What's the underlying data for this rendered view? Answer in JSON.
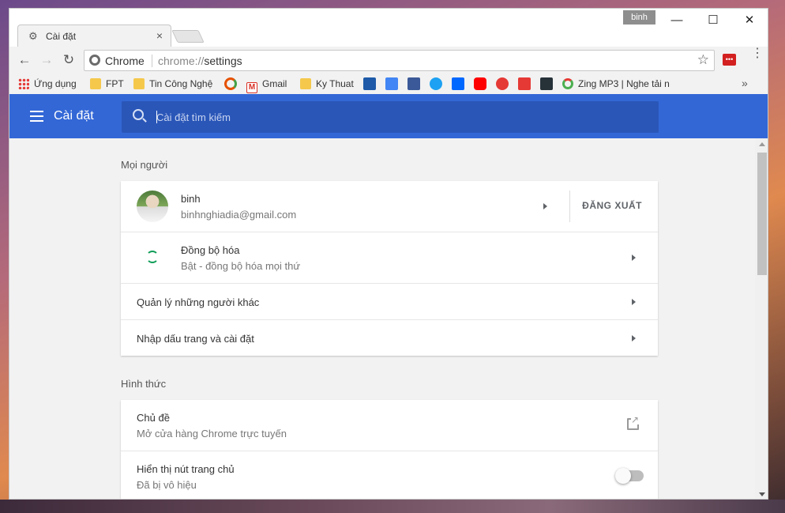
{
  "window": {
    "profile_badge": "binh",
    "controls": {
      "minimize": "—",
      "maximize": "☐",
      "close": "✕"
    }
  },
  "tab": {
    "title": "Cài đặt",
    "close": "×"
  },
  "toolbar": {
    "back": "←",
    "forward": "→",
    "reload": "↻",
    "site_label": "Chrome",
    "url_scheme": "chrome://",
    "url_path": "settings",
    "star": "☆",
    "menu": "⋮"
  },
  "bookmarks": {
    "apps_label": "Ứng dụng",
    "items": [
      {
        "label": "FPT",
        "icon": "folder-icon"
      },
      {
        "label": "Tin Công Nghệ",
        "icon": "folder-icon"
      },
      {
        "label": "Gmail",
        "icon": "gmail-icon"
      },
      {
        "label": "Ky Thuat",
        "icon": "folder-icon"
      },
      {
        "label": "Zing MP3 | Nghe tải n",
        "icon": "zing-icon"
      }
    ],
    "more": "»"
  },
  "settings_header": {
    "title": "Cài đặt",
    "search_placeholder": "Cài đặt tìm kiếm"
  },
  "people": {
    "section_title": "Mọi người",
    "account": {
      "name": "binh",
      "email": "binhnghiadia@gmail.com",
      "signout": "ĐĂNG XUẤT"
    },
    "sync": {
      "title": "Đồng bộ hóa",
      "subtitle": "Bật - đồng bộ hóa mọi thứ"
    },
    "manage_others": "Quản lý những người khác",
    "import": "Nhập dấu trang và cài đặt"
  },
  "appearance": {
    "section_title": "Hình thức",
    "theme": {
      "title": "Chủ đề",
      "subtitle": "Mở cửa hàng Chrome trực tuyến"
    },
    "home_button": {
      "title": "Hiển thị nút trang chủ",
      "subtitle": "Đã bị vô hiệu",
      "enabled": false
    }
  },
  "colors": {
    "header_blue": "#3367d6",
    "search_blue": "#2a56b8",
    "sync_green": "#0f9d58"
  }
}
